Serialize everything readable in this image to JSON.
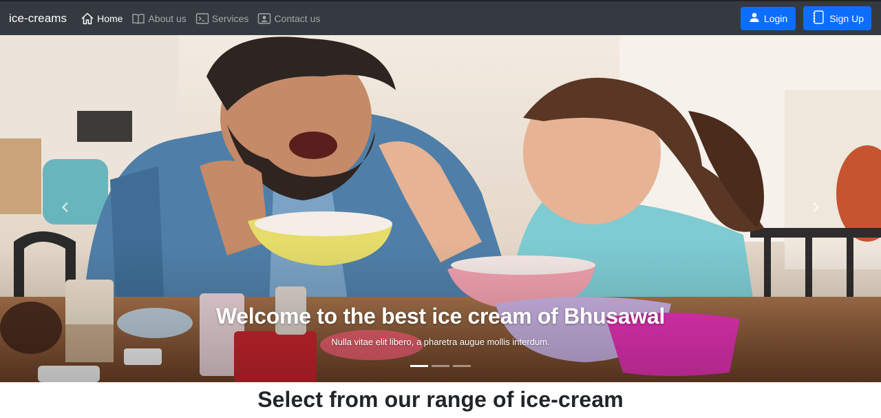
{
  "navbar": {
    "brand": "ice-creams",
    "links": [
      {
        "label": "Home",
        "icon": "house-icon"
      },
      {
        "label": "About us",
        "icon": "book-icon"
      },
      {
        "label": "Services",
        "icon": "terminal-icon"
      },
      {
        "label": "Contact us",
        "icon": "person-card-icon"
      }
    ],
    "login_label": "Login",
    "signup_label": "Sign Up"
  },
  "carousel": {
    "caption_title": "Welcome to the best ice cream of Bhusawal",
    "caption_text": "Nulla vitae elit libero, a pharetra augue mollis interdum.",
    "slides_count": 3,
    "active_slide": 0
  },
  "section": {
    "title": "Select from our range of ice-cream"
  },
  "colors": {
    "navbar_bg": "#343a40",
    "button_primary": "#0d6efd",
    "text_dark": "#212529"
  }
}
